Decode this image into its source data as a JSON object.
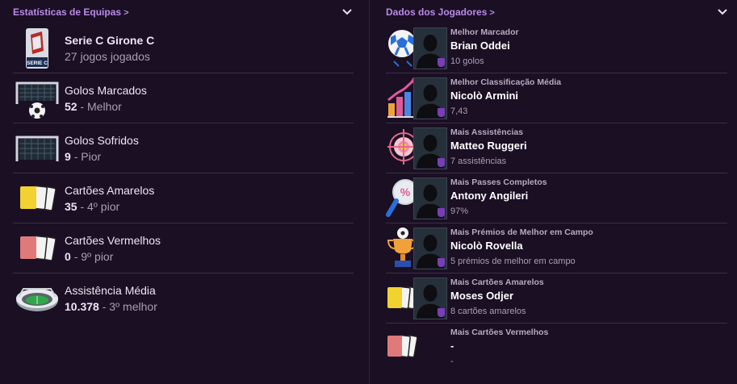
{
  "team_stats": {
    "title": "Estatísticas de Equipas",
    "title_chevron": ">",
    "league": {
      "name": "Serie C Girone C",
      "games": "27 jogos jogados",
      "logo_text": "SERIE C"
    },
    "rows": [
      {
        "label": "Golos Marcados",
        "value": "52",
        "rank": "- Melhor",
        "icon": "goal-ball-icon"
      },
      {
        "label": "Golos Sofridos",
        "value": "9",
        "rank": "- Pior",
        "icon": "goal-net-icon"
      },
      {
        "label": "Cartões Amarelos",
        "value": "35",
        "rank": "- 4º pior",
        "icon": "yellow-cards-icon"
      },
      {
        "label": "Cartões Vermelhos",
        "value": "0",
        "rank": "- 9º pior",
        "icon": "red-cards-icon"
      },
      {
        "label": "Assistência Média",
        "value": "10.378",
        "rank": "- 3º melhor",
        "icon": "stadium-icon"
      }
    ]
  },
  "player_stats": {
    "title": "Dados dos Jogadores",
    "title_chevron": ">",
    "rows": [
      {
        "category": "Melhor Marcador",
        "name": "Brian Oddei",
        "stat": "10 golos",
        "icon": "soccer-ball-icon"
      },
      {
        "category": "Melhor Classificação Média",
        "name": "Nicolò Armini",
        "stat": "7,43",
        "icon": "bar-chart-icon"
      },
      {
        "category": "Mais Assistências",
        "name": "Matteo Ruggeri",
        "stat": "7 assistências",
        "icon": "target-icon"
      },
      {
        "category": "Mais Passes Completos",
        "name": "Antony Angileri",
        "stat": "97%",
        "icon": "magnifier-icon"
      },
      {
        "category": "Mais Prémios de Melhor em Campo",
        "name": "Nicolò Rovella",
        "stat": "5 prémios de melhor em campo",
        "icon": "trophy-icon"
      },
      {
        "category": "Mais Cartões Amarelos",
        "name": "Moses Odjer",
        "stat": "8 cartões amarelos",
        "icon": "yellow-cards-icon"
      },
      {
        "category": "Mais Cartões Vermelhos",
        "name": "-",
        "stat": "-",
        "icon": "red-cards-icon"
      }
    ]
  },
  "colors": {
    "background": "#1b0f24",
    "accent": "#b98be6",
    "divider": "#3a2f43"
  }
}
